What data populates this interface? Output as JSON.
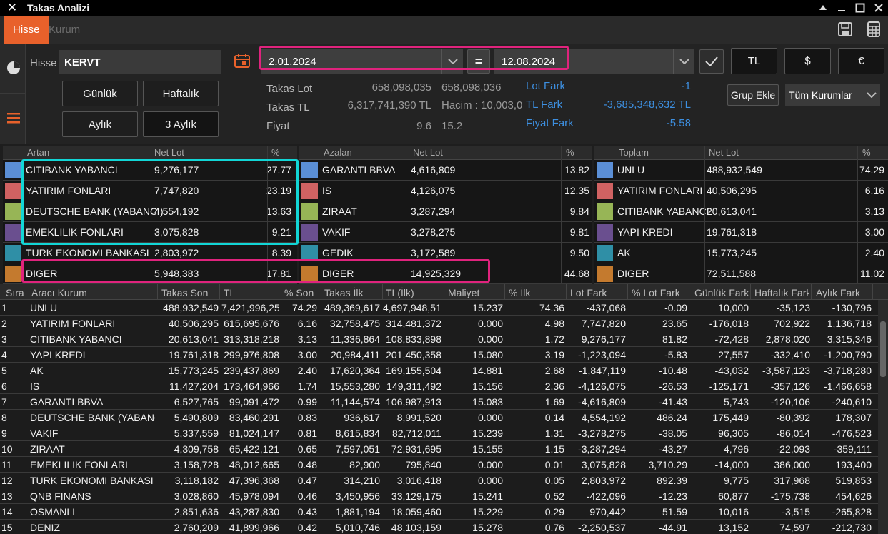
{
  "window": {
    "title": "Takas Analizi",
    "close_glyph": "✕"
  },
  "tabs": [
    {
      "label": "Hisse",
      "active": true
    },
    {
      "label": "Kurum",
      "active": false
    }
  ],
  "form": {
    "hisse_label": "Hisse",
    "hisse_value": "KERVT",
    "period_buttons": [
      "Günlük",
      "Haftalık",
      "Aylık",
      "3 Aylık"
    ],
    "date_start": "2.01.2024",
    "equals": "=",
    "date_end": "12.08.2024",
    "currency_buttons": [
      "TL",
      "$",
      "€"
    ],
    "group_add": "Grup Ekle",
    "all_institutions": "Tüm Kurumlar"
  },
  "stats": {
    "takas_lot_label": "Takas Lot",
    "takas_lot_1": "658,098,035",
    "takas_lot_2": "658,098,036",
    "takas_tl_label": "Takas TL",
    "takas_tl_1": "6,317,741,390 TL",
    "hacim": "Hacim : 10,003,0",
    "fiyat_label": "Fiyat",
    "fiyat_1": "9.6",
    "fiyat_2": "15.2",
    "lot_fark_label": "Lot Fark",
    "lot_fark": "-1",
    "tl_fark_label": "TL Fark",
    "tl_fark": "-3,685,348,632 TL",
    "fiyat_fark_label": "Fiyat Fark",
    "fiyat_fark": "-5.58"
  },
  "artan": {
    "headers": [
      "Artan",
      "Net Lot",
      "%"
    ],
    "rows": [
      {
        "name": "CITIBANK YABANCI",
        "lot": "9,276,177",
        "pct": "27.77",
        "color": "#5b8fd6"
      },
      {
        "name": "YATIRIM FONLARI",
        "lot": "7,747,820",
        "pct": "23.19",
        "color": "#d06262"
      },
      {
        "name": "DEUTSCHE BANK (YABANCI)",
        "lot": "4,554,192",
        "pct": "13.63",
        "color": "#97b556"
      },
      {
        "name": "EMEKLILIK FONLARI",
        "lot": "3,075,828",
        "pct": "9.21",
        "color": "#6a4f8f"
      },
      {
        "name": "TURK EKONOMI BANKASI",
        "lot": "2,803,972",
        "pct": "8.39",
        "color": "#2f8fa6"
      },
      {
        "name": "DIGER",
        "lot": "5,948,383",
        "pct": "17.81",
        "color": "#c47a2e"
      }
    ]
  },
  "azalan": {
    "headers": [
      "Azalan",
      "Net Lot",
      "%"
    ],
    "rows": [
      {
        "name": "GARANTI BBVA",
        "lot": "4,616,809",
        "pct": "13.82",
        "color": "#5b8fd6"
      },
      {
        "name": "IS",
        "lot": "4,126,075",
        "pct": "12.35",
        "color": "#d06262"
      },
      {
        "name": "ZIRAAT",
        "lot": "3,287,294",
        "pct": "9.84",
        "color": "#97b556"
      },
      {
        "name": "VAKIF",
        "lot": "3,278,275",
        "pct": "9.81",
        "color": "#6a4f8f"
      },
      {
        "name": "GEDIK",
        "lot": "3,172,589",
        "pct": "9.50",
        "color": "#2f8fa6"
      },
      {
        "name": "DIGER",
        "lot": "14,925,329",
        "pct": "44.68",
        "color": "#c47a2e"
      }
    ]
  },
  "toplam": {
    "headers": [
      "Toplam",
      "Net Lot",
      "%"
    ],
    "rows": [
      {
        "name": "UNLU",
        "lot": "488,932,549",
        "pct": "74.29",
        "color": "#5b8fd6"
      },
      {
        "name": "YATIRIM FONLARI",
        "lot": "40,506,295",
        "pct": "6.16",
        "color": "#d06262"
      },
      {
        "name": "CITIBANK YABANCI",
        "lot": "20,613,041",
        "pct": "3.13",
        "color": "#97b556"
      },
      {
        "name": "YAPI KREDI",
        "lot": "19,761,318",
        "pct": "3.00",
        "color": "#6a4f8f"
      },
      {
        "name": "AK",
        "lot": "15,773,245",
        "pct": "2.40",
        "color": "#2f8fa6"
      },
      {
        "name": "DIGER",
        "lot": "72,511,588",
        "pct": "11.02",
        "color": "#c47a2e"
      }
    ]
  },
  "main_table": {
    "headers": [
      "Sıra",
      "Aracı Kurum",
      "Takas Son",
      "TL",
      "% Son",
      "Takas İlk",
      "TL(İlk)",
      "Maliyet",
      "% İlk",
      "Lot Fark",
      "% Lot Fark",
      "Günlük Fark",
      "Haftalık Fark",
      "Aylık Fark"
    ],
    "rows": [
      [
        "1",
        "UNLU",
        "488,932,549",
        "7,421,996,250",
        "74.29",
        "489,369,617",
        "4,697,948,514",
        "15.237",
        "74.36",
        "-437,068",
        "-0.09",
        "10,000",
        "-35,123",
        "-130,796"
      ],
      [
        "2",
        "YATIRIM FONLARI",
        "40,506,295",
        "615,695,676",
        "6.16",
        "32,758,475",
        "314,481,372",
        "0.000",
        "4.98",
        "7,747,820",
        "23.65",
        "-176,018",
        "702,922",
        "1,136,718"
      ],
      [
        "3",
        "CITIBANK YABANCI",
        "20,613,041",
        "313,318,218",
        "3.13",
        "11,336,864",
        "108,833,898",
        "0.000",
        "1.72",
        "9,276,177",
        "81.82",
        "-72,428",
        "2,878,020",
        "3,315,346"
      ],
      [
        "4",
        "YAPI KREDI",
        "19,761,318",
        "299,976,808",
        "3.00",
        "20,984,411",
        "201,450,358",
        "15.080",
        "3.19",
        "-1,223,094",
        "-5.83",
        "27,557",
        "-332,410",
        "-1,200,790"
      ],
      [
        "5",
        "AK",
        "15,773,245",
        "239,437,869",
        "2.40",
        "17,620,364",
        "169,155,504",
        "14.881",
        "2.68",
        "-1,847,119",
        "-10.48",
        "-43,032",
        "-3,587,123",
        "-3,718,280"
      ],
      [
        "6",
        "IS",
        "11,427,204",
        "173,464,966",
        "1.74",
        "15,553,280",
        "149,311,492",
        "15.156",
        "2.36",
        "-4,126,075",
        "-26.53",
        "-125,171",
        "-357,126",
        "-1,466,658"
      ],
      [
        "7",
        "GARANTI BBVA",
        "6,527,765",
        "99,091,472",
        "0.99",
        "11,144,574",
        "106,987,913",
        "15.083",
        "1.69",
        "-4,616,809",
        "-41.43",
        "5,743",
        "-120,106",
        "-240,610"
      ],
      [
        "8",
        "DEUTSCHE BANK (YABANCI)",
        "5,490,809",
        "83,460,291",
        "0.83",
        "936,617",
        "8,991,520",
        "0.000",
        "0.14",
        "4,554,192",
        "486.24",
        "175,449",
        "-80,392",
        "178,307"
      ],
      [
        "9",
        "VAKIF",
        "5,337,559",
        "81,024,147",
        "0.81",
        "8,615,834",
        "82,712,011",
        "15.239",
        "1.31",
        "-3,278,275",
        "-38.05",
        "96,305",
        "-86,014",
        "-476,523"
      ],
      [
        "10",
        "ZIRAAT",
        "4,309,758",
        "65,422,121",
        "0.65",
        "7,597,051",
        "72,931,695",
        "15.155",
        "1.15",
        "-3,287,294",
        "-43.27",
        "4,796",
        "-22,093",
        "-359,111"
      ],
      [
        "11",
        "EMEKLILIK FONLARI",
        "3,158,728",
        "48,012,665",
        "0.48",
        "82,900",
        "795,840",
        "0.000",
        "0.01",
        "3,075,828",
        "3,710.29",
        "-14,000",
        "386,000",
        "193,400"
      ],
      [
        "12",
        "TURK EKONOMI BANKASI",
        "3,118,182",
        "47,396,368",
        "0.47",
        "314,210",
        "3,016,418",
        "0.000",
        "0.05",
        "2,803,972",
        "892.39",
        "9,775",
        "317,968",
        "519,853"
      ],
      [
        "13",
        "QNB FINANS",
        "3,028,860",
        "45,978,094",
        "0.46",
        "3,450,956",
        "33,129,175",
        "15.241",
        "0.52",
        "-422,096",
        "-12.23",
        "60,877",
        "-175,738",
        "454,626"
      ],
      [
        "14",
        "OSMANLI",
        "2,851,636",
        "43,287,830",
        "0.43",
        "1,881,194",
        "18,059,460",
        "15.229",
        "0.29",
        "970,442",
        "51.59",
        "10,016",
        "-3,515",
        "-265,828"
      ],
      [
        "15",
        "DENIZ",
        "2,760,209",
        "41,899,966",
        "0.42",
        "5,010,746",
        "48,103,159",
        "15.278",
        "0.76",
        "-2,250,537",
        "-44.91",
        "13,152",
        "74,597",
        "-212,730"
      ]
    ]
  }
}
